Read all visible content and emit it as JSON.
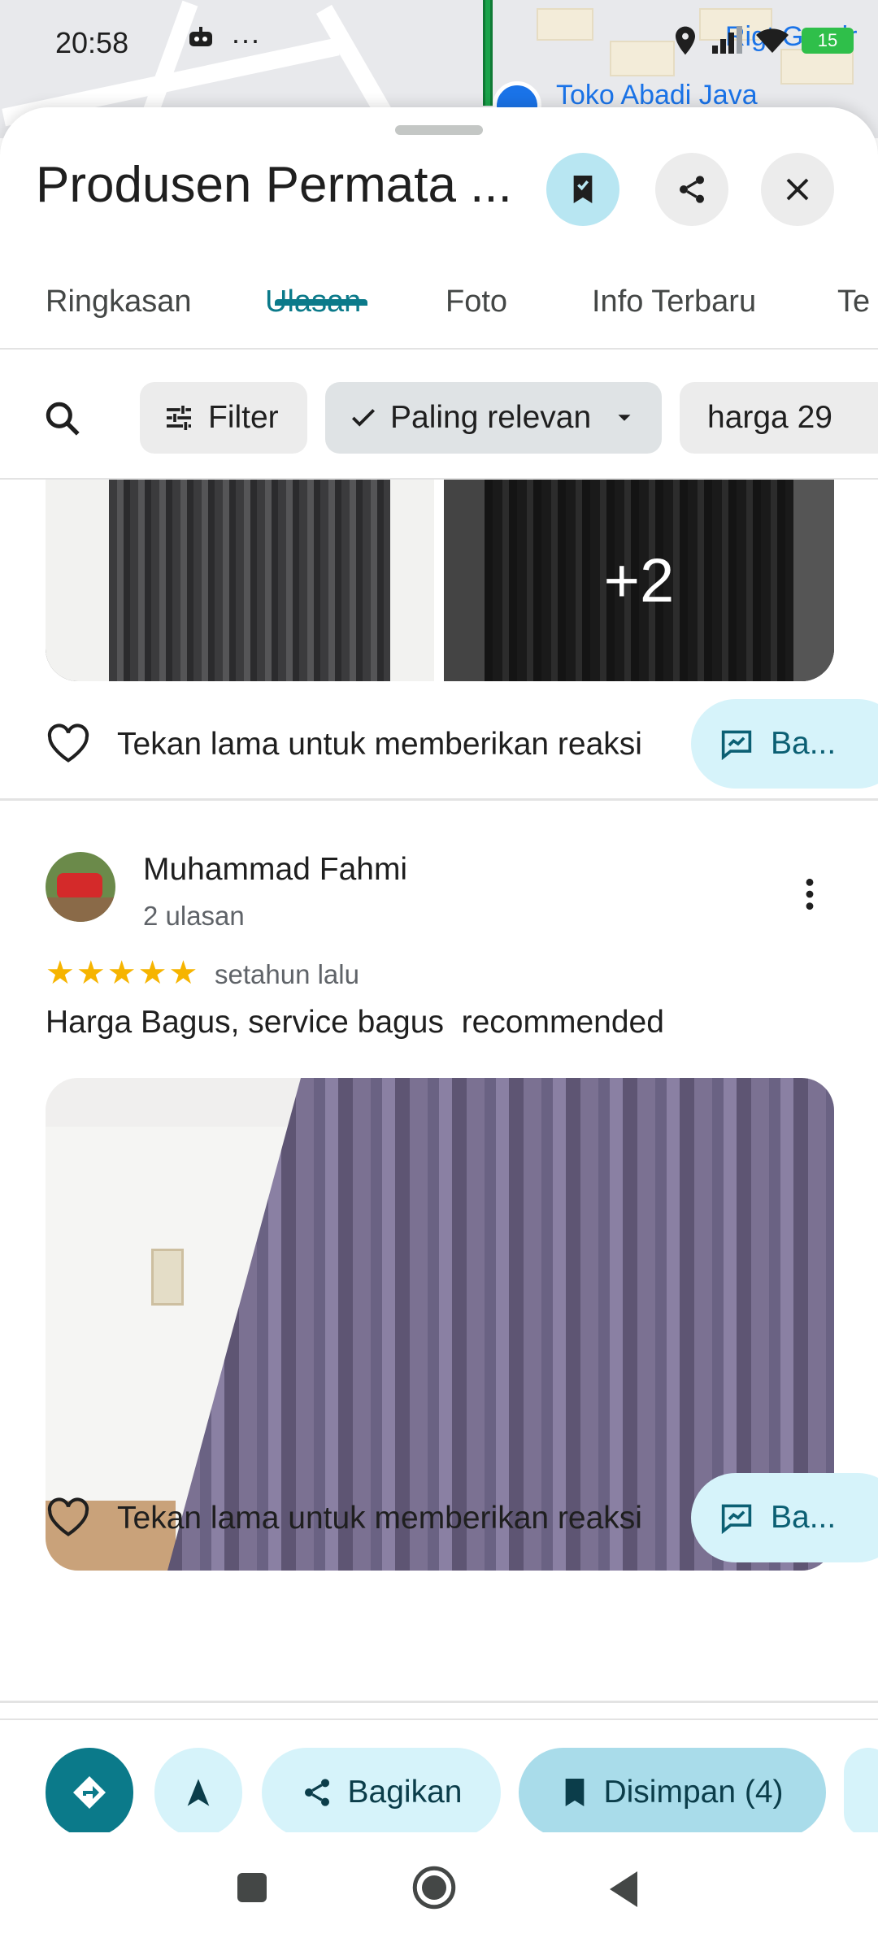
{
  "status_bar": {
    "time": "20:58",
    "more": "···",
    "battery": "15"
  },
  "map": {
    "label_1": "Toko Abadi Java",
    "label_2": "Rigt Grosir"
  },
  "place": {
    "title": "Produsen Permata ..."
  },
  "tabs": [
    {
      "label": "Ringkasan"
    },
    {
      "label": "Ulasan"
    },
    {
      "label": "Foto"
    },
    {
      "label": "Info Terbaru"
    },
    {
      "label": "Te"
    }
  ],
  "filters": {
    "filter_label": "Filter",
    "sort_label": "Paling relevan",
    "topic_chip": "harga 29"
  },
  "previous_review": {
    "more_photos": "+2",
    "reaction_hint": "Tekan lama untuk memberikan reaksi",
    "reply_label": "Ba..."
  },
  "review": {
    "reviewer_name": "Muhammad Fahmi",
    "reviewer_meta": "2 ulasan",
    "rating": 5,
    "stars": "★★★★★",
    "when": "setahun lalu",
    "text": "Harga Bagus, service bagus  recommended",
    "reaction_hint": "Tekan lama untuk memberikan reaksi",
    "reply_label": "Ba..."
  },
  "actions": {
    "share_label": "Bagikan",
    "saved_label": "Disimpan (4)"
  },
  "colors": {
    "accent": "#0b7a8a",
    "chip_light": "#d6f3fa",
    "star": "#f6b400"
  }
}
